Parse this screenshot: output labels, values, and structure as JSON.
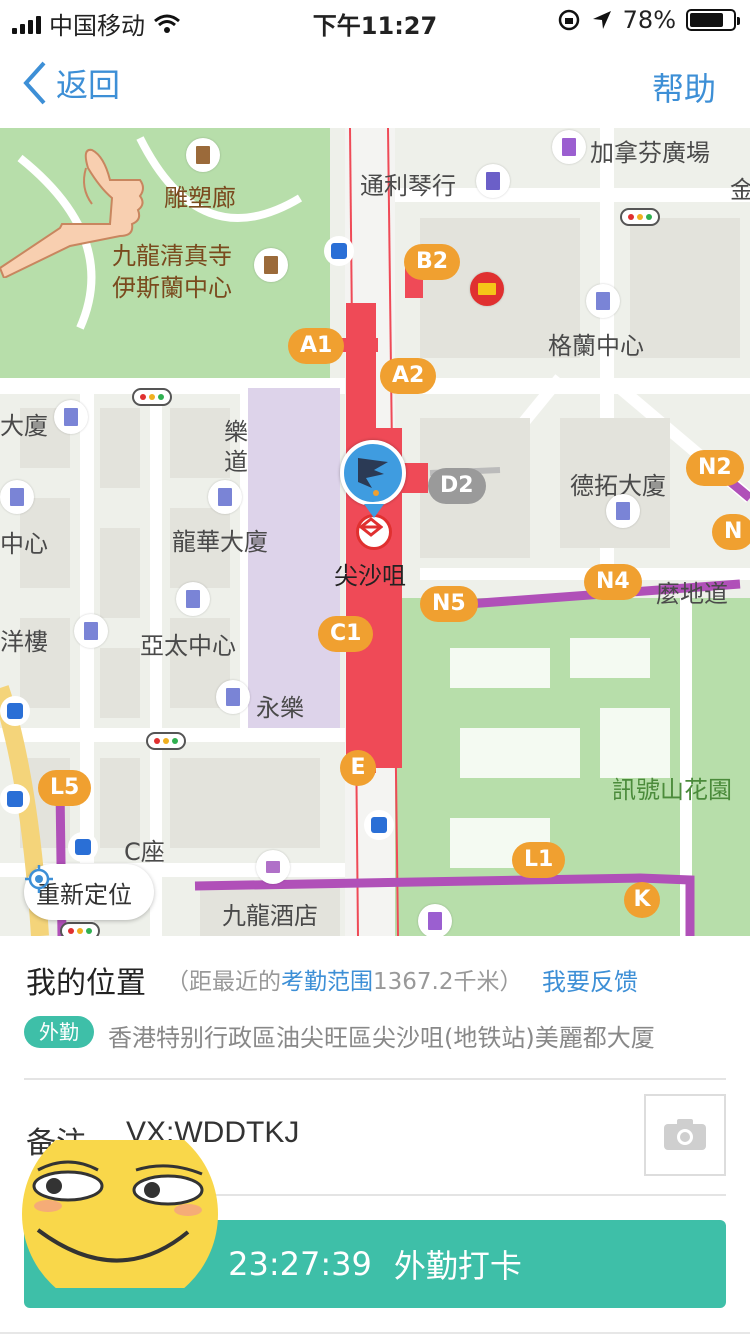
{
  "status_bar": {
    "carrier": "中国移动",
    "time": "下午11:27",
    "battery": "78%",
    "battery_level": 0.78
  },
  "nav": {
    "back_label": "返回",
    "help_label": "帮助"
  },
  "map": {
    "labels": {
      "sculpture_gallery": "雕塑廊",
      "mosque_1": "九龍清真寺",
      "mosque_2": "伊斯蘭中心",
      "tunnel_shop": "通利琴行",
      "canadian_plaza": "加拿芬廣場",
      "grand_centre": "格蘭中心",
      "le_dao_1": "樂",
      "le_dao_2": "道",
      "left_tower": "大廈",
      "left_centre": "中心",
      "dragon_tower": "龍華大廈",
      "tsim_sha_tsui": "尖沙咀",
      "ocean_building": "洋樓",
      "asia_centre": "亞太中心",
      "wing_lok": "永樂",
      "deta_tower": "德拓大廈",
      "mody_road": "麼地道",
      "signal_hill": "訊號山花園",
      "c_block": "C座",
      "kowloon_hotel": "九龍酒店",
      "corner_char": "金"
    },
    "exits": [
      "B2",
      "A1",
      "A2",
      "D2",
      "N2",
      "N4",
      "N5",
      "C1",
      "E",
      "L5",
      "L1",
      "K",
      "N"
    ],
    "relocate_label": "重新定位"
  },
  "panel": {
    "my_location": "我的位置",
    "distance_prefix": "（距最近的",
    "attendance_range": "考勤范围",
    "distance_suffix": "1367.2千米）",
    "feedback": "我要反馈",
    "tag": "外勤",
    "address": "香港特别行政區油尖旺區尖沙咀(地铁站)美麗都大厦",
    "note_label": "备注",
    "note_value": "VX:WDDTKJ",
    "punch_time": "23:27:39",
    "punch_label": "外勤打卡"
  },
  "colors": {
    "accent_blue": "#3d8fd6",
    "teal": "#3ebfa8",
    "exit_orange": "#f0a030",
    "metro_red": "#ef4a57",
    "route_purple": "#b050b8"
  }
}
